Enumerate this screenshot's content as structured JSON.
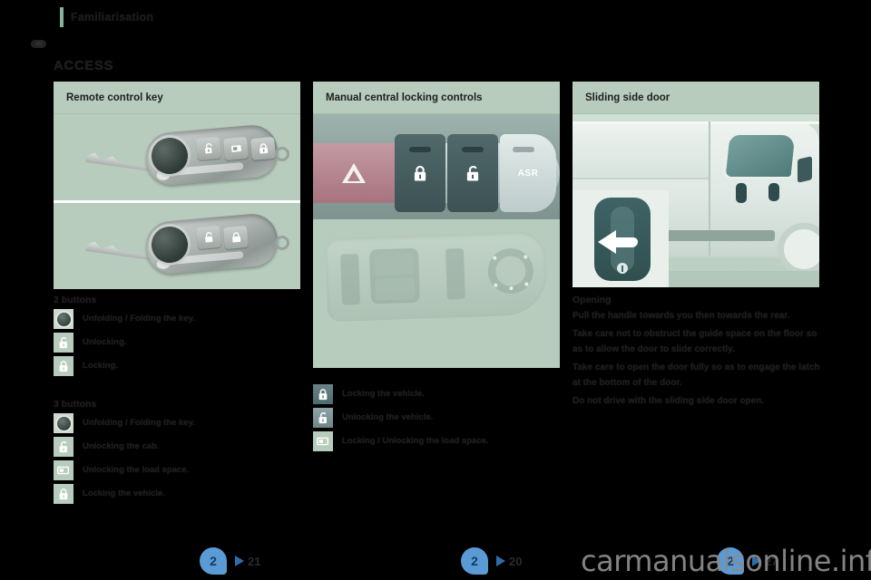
{
  "header": {
    "title": "Familiarisation",
    "page_marker": "20",
    "section_title": "ACCESS"
  },
  "panels": {
    "remote": {
      "heading": "Remote control key"
    },
    "manual": {
      "heading": "Manual central locking controls"
    },
    "sliding": {
      "heading": "Sliding side door"
    }
  },
  "artwork": {
    "asr_label": "ASR"
  },
  "legend_two_buttons": {
    "title": "2 buttons",
    "rows": [
      {
        "icon": "key-fob-button-icon",
        "label": "Unfolding / Folding the key."
      },
      {
        "icon": "unlock-icon",
        "label": "Unlocking."
      },
      {
        "icon": "lock-icon",
        "label": "Locking."
      }
    ]
  },
  "legend_three_buttons": {
    "title": "3 buttons",
    "rows": [
      {
        "icon": "key-fob-button-icon",
        "label": "Unfolding / Folding the key."
      },
      {
        "icon": "unlock-cab-icon",
        "label": "Unlocking the cab."
      },
      {
        "icon": "load-space-icon",
        "label": "Unlocking the load space."
      },
      {
        "icon": "lock-icon",
        "label": "Locking the vehicle."
      }
    ]
  },
  "legend_central_locking": {
    "rows": [
      {
        "icon": "lock-icon",
        "label": "Locking the vehicle."
      },
      {
        "icon": "unlock-icon",
        "label": "Unlocking the vehicle."
      },
      {
        "icon": "load-space-icon",
        "label": "Locking / Unlocking the load space."
      }
    ]
  },
  "sliding_door_text": {
    "heading": "Opening",
    "paragraphs": [
      "Pull the handle towards you then towards the rear.",
      "Take care not to obstruct the guide space on the floor so as to allow the door to slide correctly.",
      "Take care to open the door fully so as to engage the latch at the bottom of the door.",
      "Do not drive with the sliding side door open."
    ]
  },
  "footers": [
    {
      "chapter": "2",
      "page": "21"
    },
    {
      "chapter": "2",
      "page": "20"
    },
    {
      "chapter": "2",
      "page": "27"
    }
  ],
  "watermark": "carmanualsonline.info",
  "colors": {
    "panel_green": "#b7ccbd",
    "accent_blue": "#5b9bd5",
    "page_background": "#000000"
  }
}
